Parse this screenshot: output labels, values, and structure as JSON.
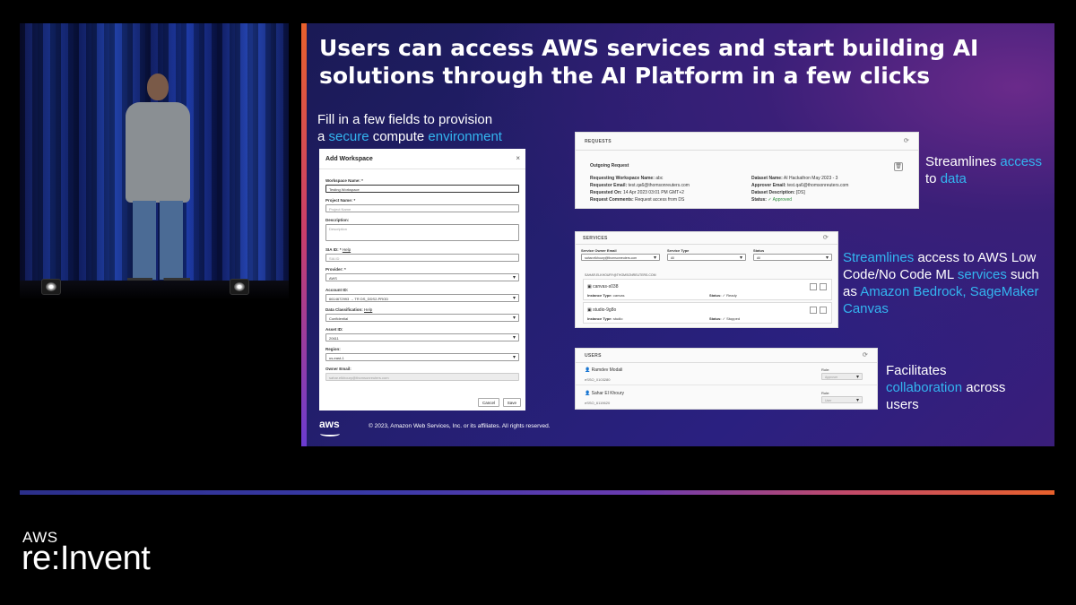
{
  "slide": {
    "title": "Users can access AWS services and start building AI solutions through the AI Platform in a few clicks",
    "caption_form": {
      "p1": "Fill in a few fields to provision",
      "p2": "a ",
      "p3": "secure",
      "p4": " compute ",
      "p5": "environment"
    },
    "caption_requests": {
      "p1": "Streamlines ",
      "p2": "access",
      "p3": "to ",
      "p4": "data"
    },
    "caption_services": {
      "p1": "Streamlines",
      "p2": " access to AWS Low Code/No Code ML ",
      "p3": "services",
      "p4": " such as ",
      "p5": "Amazon Bedrock, SageMaker Canvas"
    },
    "caption_users": {
      "p1": "Facilitates",
      "p2": "collaboration",
      "p3": " across",
      "p4": "users"
    },
    "aws_logo": "aws",
    "copyright": "© 2023, Amazon Web Services, Inc. or its affiliates. All rights reserved."
  },
  "form": {
    "title": "Add Workspace",
    "close": "×",
    "fields": [
      {
        "label": "Workspace Name: *",
        "value": "Testing Workspace"
      },
      {
        "label": "Project Name: *",
        "value": "Project Name"
      },
      {
        "label": "Description:",
        "value": "Description"
      },
      {
        "label": "SIA ID: *",
        "value": "SIA ID",
        "help": "Help"
      },
      {
        "label": "Provider: *",
        "value": "AWS"
      },
      {
        "label": "Account ID:",
        "value": "6614672993 → TR DS_DDS2-PROD"
      },
      {
        "label": "Data Classification:",
        "value": "Confidential",
        "help": "Help"
      },
      {
        "label": "Asset ID:",
        "value": "20611"
      },
      {
        "label": "Region:",
        "value": "us-east-1"
      },
      {
        "label": "Owner Email:",
        "value": "sahar.elkhoury@thomsonreuters.com"
      }
    ],
    "cancel": "Cancel",
    "save": "Save"
  },
  "requests": {
    "header": "REQUESTS",
    "section": "Outgoing Request",
    "left": [
      {
        "k": "Requesting Workspace Name:",
        "v": "abc"
      },
      {
        "k": "Requestor Email:",
        "v": "test.qa6@thomsonreuters.com"
      },
      {
        "k": "Requested On:",
        "v": "14 Apr 2023 03:01 PM GMT+2"
      },
      {
        "k": "Request Comments:",
        "v": "Request access from DS"
      }
    ],
    "right": [
      {
        "k": "Dataset Name:",
        "v": "AI Hackathon May 2023 - 3"
      },
      {
        "k": "Approver Email:",
        "v": "test.qa6@thomsonreuters.com"
      },
      {
        "k": "Dataset Description:",
        "v": "[DS]"
      },
      {
        "k": "Status:",
        "v": "✓ Approved"
      }
    ]
  },
  "services": {
    "header": "SERVICES",
    "filters": [
      {
        "label": "Service Owner Email",
        "value": "sahar.elkhoury@thomsonreuters.com"
      },
      {
        "label": "Service Type",
        "value": "All"
      },
      {
        "label": "Status",
        "value": "All"
      }
    ],
    "owner": "SAHAR.ELKHOURY@THOMSONREUTERS.COM",
    "items": [
      {
        "name": "canvas-s038",
        "type_label": "Instance Type:",
        "type": "canvas",
        "status_label": "Status:",
        "status": "✓ Ready"
      },
      {
        "name": "studio-9g8o",
        "type_label": "Instance Type:",
        "type": "studio",
        "status_label": "Status:",
        "status": "✓ Stopped"
      }
    ]
  },
  "users": {
    "header": "USERS",
    "list": [
      {
        "name": "Ramdev Modali",
        "id": "eSSO_0103280",
        "role_label": "Role:",
        "role": "Approver"
      },
      {
        "name": "Sahar El Khoury",
        "id": "eSSO_6119620",
        "role_label": "Role:",
        "role": "User"
      }
    ]
  },
  "brand": {
    "aws": "AWS",
    "reinvent": "re:Invent"
  }
}
